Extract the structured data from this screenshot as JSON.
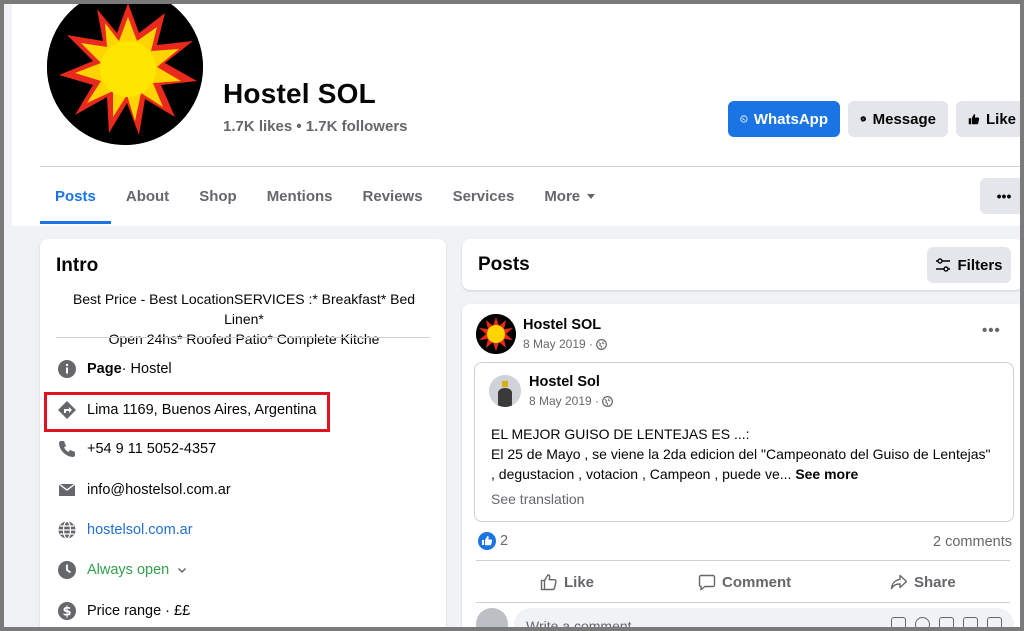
{
  "header": {
    "page_name": "Hostel SOL",
    "stats": "1.7K likes • 1.7K followers",
    "buttons": {
      "whatsapp": "WhatsApp",
      "message": "Message",
      "like": "Like"
    }
  },
  "tabs": [
    {
      "label": "Posts",
      "active": true
    },
    {
      "label": "About"
    },
    {
      "label": "Shop"
    },
    {
      "label": "Mentions"
    },
    {
      "label": "Reviews"
    },
    {
      "label": "Services"
    },
    {
      "label": "More"
    }
  ],
  "more_options": "•••",
  "intro": {
    "title": "Intro",
    "bio_line1": "Best Price - Best LocationSERVICES :* Breakfast* Bed Linen*",
    "bio_line2": "Open 24hs* Roofed Patio* Complete Kitche",
    "page_label": "Page",
    "page_category": " · Hostel",
    "address": "Lima 1169, Buenos Aires, Argentina",
    "phone": "+54 9 11 5052-4357",
    "email": "info@hostelsol.com.ar",
    "website": "hostelsol.com.ar",
    "hours": "Always open",
    "price_range": "Price range · ££"
  },
  "posts_header": {
    "title": "Posts",
    "filters": "Filters"
  },
  "post": {
    "author": "Hostel SOL",
    "date": "8 May 2019 ·",
    "options": "•••",
    "shared": {
      "author": "Hostel Sol",
      "date": "8 May 2019 ·",
      "text_line1": "EL MEJOR GUISO DE LENTEJAS ES ...:",
      "text_line2": "El 25 de Mayo , se viene la 2da edicion del \"Campeonato del Guiso de Lentejas\"",
      "text_line3": ", degustacion , votacion , Campeon , puede ve...",
      "see_more": "See more",
      "see_translation": "See translation"
    },
    "reaction_count": "2",
    "comments_count": "2 comments",
    "actions": {
      "like": "Like",
      "comment": "Comment",
      "share": "Share"
    },
    "comment_placeholder": "Write a comment..."
  },
  "colors": {
    "accent": "#1b74e4",
    "highlight": "#e0141e",
    "open_status": "#31a24c",
    "link": "#216fdb"
  }
}
